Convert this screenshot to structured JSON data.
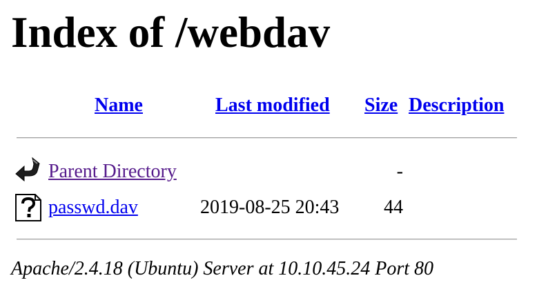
{
  "page": {
    "title": "Index of /webdav"
  },
  "table": {
    "headers": {
      "name": "Name",
      "last_modified": "Last modified",
      "size": "Size",
      "description": "Description"
    },
    "rows": [
      {
        "icon": "back-arrow-icon",
        "name": "Parent Directory",
        "last_modified": "",
        "size": "-",
        "description": ""
      },
      {
        "icon": "unknown-file-icon",
        "name": "passwd.dav",
        "last_modified": "2019-08-25 20:43",
        "size": "44",
        "description": ""
      }
    ]
  },
  "footer": {
    "signature": "Apache/2.4.18 (Ubuntu) Server at 10.10.45.24 Port 80"
  },
  "colors": {
    "link": "#0000ee",
    "visited_link": "#551a8b",
    "text": "#000000",
    "background": "#ffffff"
  }
}
